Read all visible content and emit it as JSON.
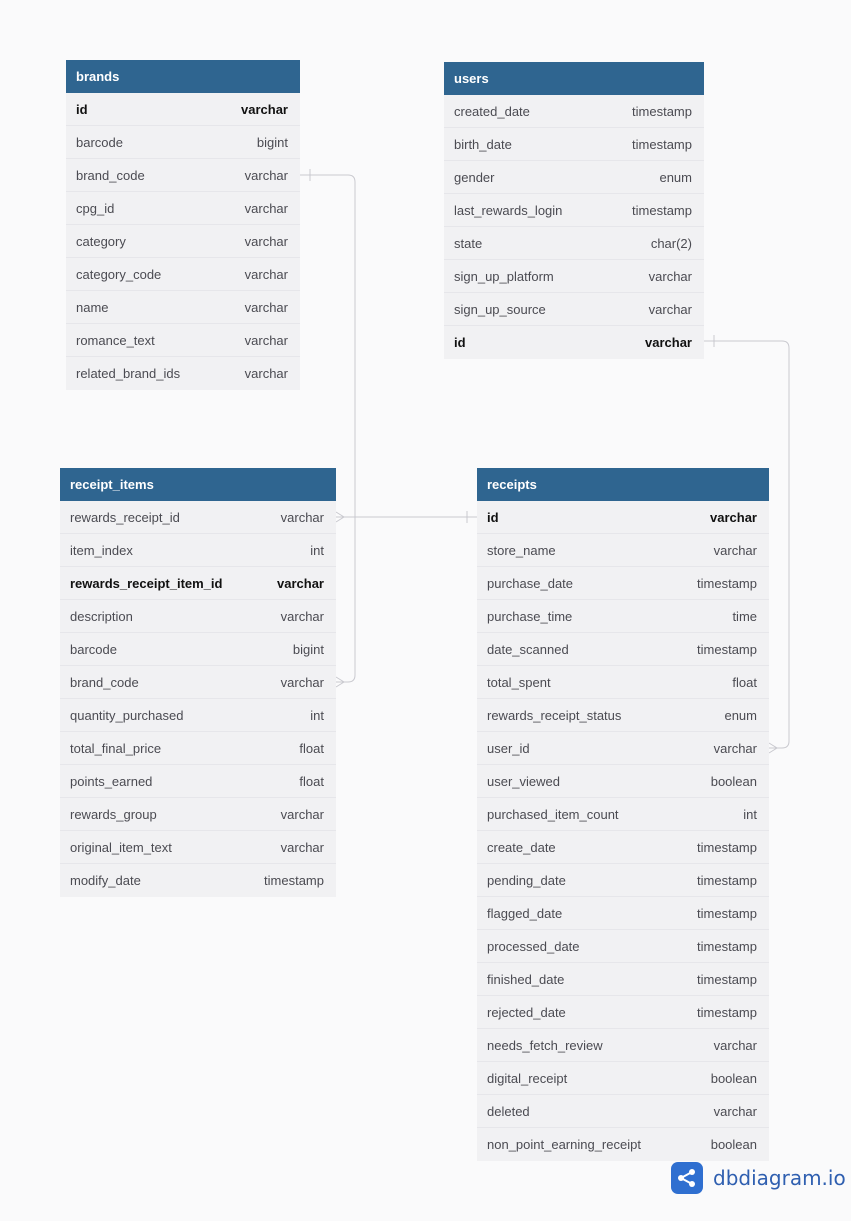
{
  "tables": {
    "brands": {
      "title": "brands",
      "fields": [
        {
          "name": "id",
          "type": "varchar",
          "pk": true
        },
        {
          "name": "barcode",
          "type": "bigint"
        },
        {
          "name": "brand_code",
          "type": "varchar"
        },
        {
          "name": "cpg_id",
          "type": "varchar"
        },
        {
          "name": "category",
          "type": "varchar"
        },
        {
          "name": "category_code",
          "type": "varchar"
        },
        {
          "name": "name",
          "type": "varchar"
        },
        {
          "name": "romance_text",
          "type": "varchar"
        },
        {
          "name": "related_brand_ids",
          "type": "varchar"
        }
      ]
    },
    "users": {
      "title": "users",
      "fields": [
        {
          "name": "created_date",
          "type": "timestamp"
        },
        {
          "name": "birth_date",
          "type": "timestamp"
        },
        {
          "name": "gender",
          "type": "enum"
        },
        {
          "name": "last_rewards_login",
          "type": "timestamp"
        },
        {
          "name": "state",
          "type": "char(2)"
        },
        {
          "name": "sign_up_platform",
          "type": "varchar"
        },
        {
          "name": "sign_up_source",
          "type": "varchar"
        },
        {
          "name": "id",
          "type": "varchar",
          "pk": true
        }
      ]
    },
    "receipt_items": {
      "title": "receipt_items",
      "fields": [
        {
          "name": "rewards_receipt_id",
          "type": "varchar"
        },
        {
          "name": "item_index",
          "type": "int"
        },
        {
          "name": "rewards_receipt_item_id",
          "type": "varchar",
          "pk": true
        },
        {
          "name": "description",
          "type": "varchar"
        },
        {
          "name": "barcode",
          "type": "bigint"
        },
        {
          "name": "brand_code",
          "type": "varchar"
        },
        {
          "name": "quantity_purchased",
          "type": "int"
        },
        {
          "name": "total_final_price",
          "type": "float"
        },
        {
          "name": "points_earned",
          "type": "float"
        },
        {
          "name": "rewards_group",
          "type": "varchar"
        },
        {
          "name": "original_item_text",
          "type": "varchar"
        },
        {
          "name": "modify_date",
          "type": "timestamp"
        }
      ]
    },
    "receipts": {
      "title": "receipts",
      "fields": [
        {
          "name": "id",
          "type": "varchar",
          "pk": true
        },
        {
          "name": "store_name",
          "type": "varchar"
        },
        {
          "name": "purchase_date",
          "type": "timestamp"
        },
        {
          "name": "purchase_time",
          "type": "time"
        },
        {
          "name": "date_scanned",
          "type": "timestamp"
        },
        {
          "name": "total_spent",
          "type": "float"
        },
        {
          "name": "rewards_receipt_status",
          "type": "enum"
        },
        {
          "name": "user_id",
          "type": "varchar"
        },
        {
          "name": "user_viewed",
          "type": "boolean"
        },
        {
          "name": "purchased_item_count",
          "type": "int"
        },
        {
          "name": "create_date",
          "type": "timestamp"
        },
        {
          "name": "pending_date",
          "type": "timestamp"
        },
        {
          "name": "flagged_date",
          "type": "timestamp"
        },
        {
          "name": "processed_date",
          "type": "timestamp"
        },
        {
          "name": "finished_date",
          "type": "timestamp"
        },
        {
          "name": "rejected_date",
          "type": "timestamp"
        },
        {
          "name": "needs_fetch_review",
          "type": "varchar"
        },
        {
          "name": "digital_receipt",
          "type": "boolean"
        },
        {
          "name": "deleted",
          "type": "varchar"
        },
        {
          "name": "non_point_earning_receipt",
          "type": "boolean"
        }
      ]
    }
  },
  "relationships": [
    {
      "from": "brands.brand_code",
      "from_cardinality": "one",
      "to": "receipt_items.brand_code",
      "to_cardinality": "many"
    },
    {
      "from": "receipts.id",
      "from_cardinality": "one",
      "to": "receipt_items.rewards_receipt_id",
      "to_cardinality": "many"
    },
    {
      "from": "users.id",
      "from_cardinality": "one",
      "to": "receipts.user_id",
      "to_cardinality": "many"
    }
  ],
  "branding": {
    "logo_text": "dbdiagram.io",
    "logo_icon": "share-nodes-icon"
  },
  "colors": {
    "header": "#2f6590",
    "body": "#f1f1f3",
    "link": "#c9c9cf",
    "brand": "#2f6fd0"
  }
}
